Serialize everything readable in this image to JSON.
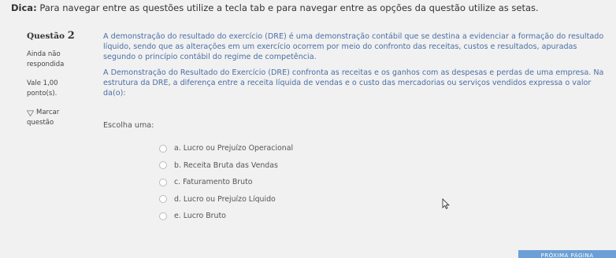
{
  "tip": {
    "label": "Dica:",
    "text": "Para navegar entre as questões utilize a tecla tab e para navegar entre as opções da questão utilize as setas."
  },
  "sidebar": {
    "question_label": "Questão",
    "question_number": "2",
    "status_line1": "Ainda não",
    "status_line2": "respondida",
    "points_line1": "Vale 1,00",
    "points_line2": "ponto(s).",
    "flag_label": "Marcar",
    "flag_label2": "questão"
  },
  "question": {
    "paragraph1": "A demonstração do resultado do exercício (DRE) é uma demonstração contábil que se destina a evidenciar a formação do resultado líquido, sendo que as alterações em um exercício ocorrem por meio do confronto das receitas, custos e resultados, apuradas segundo o princípio contábil do regime de competência.",
    "paragraph2": "A Demonstração do Resultado do Exercício (DRE) confronta as receitas e os ganhos com as despesas e perdas de uma empresa. Na estrutura da DRE, a diferença entre a receita líquida de vendas e o custo das mercadorias ou serviços vendidos expressa o valor da(o):"
  },
  "choose_label": "Escolha uma:",
  "options": [
    {
      "label": "a. Lucro ou Prejuízo Operacional"
    },
    {
      "label": "b. Receita Bruta das Vendas"
    },
    {
      "label": "c. Faturamento Bruto"
    },
    {
      "label": "d. Lucro ou Prejuízo Líquido"
    },
    {
      "label": "e. Lucro Bruto"
    }
  ],
  "next_button": {
    "label": "PRÓXIMA PÁGINA"
  },
  "icons": {
    "flag": "flag-icon",
    "cursor": "mouse-pointer-icon"
  }
}
